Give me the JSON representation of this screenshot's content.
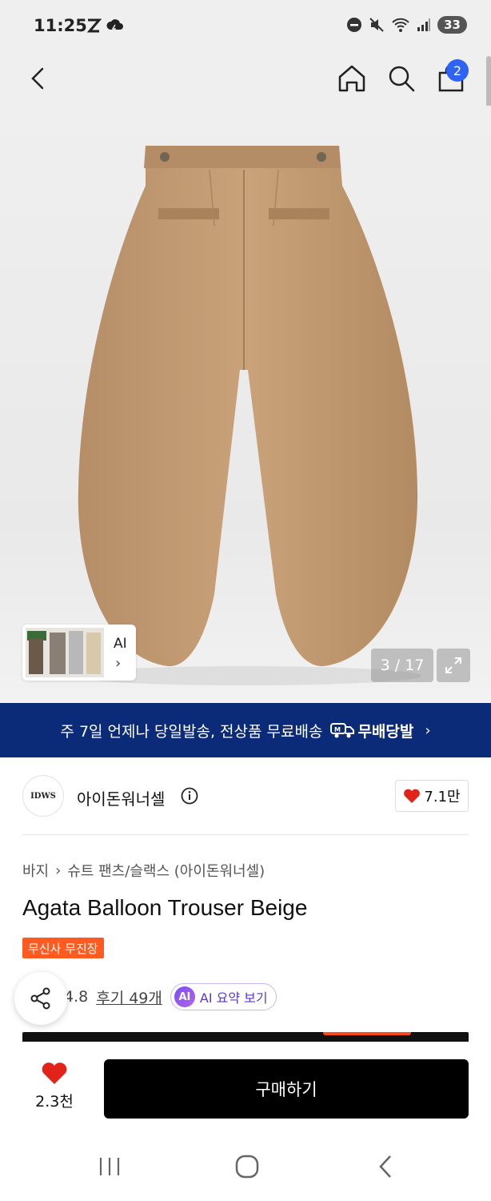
{
  "status_bar": {
    "time": "11:25",
    "battery": "33",
    "left_icons": [
      "z-app-icon",
      "weather-icon"
    ],
    "right_icons": [
      "dnd-icon",
      "mute-icon",
      "wifi-icon",
      "signal-icon",
      "battery-icon"
    ]
  },
  "header": {
    "back_icon": "chevron-left-icon",
    "home_icon": "home-icon",
    "search_icon": "search-icon",
    "cart_icon": "cart-icon",
    "cart_badge": "2"
  },
  "gallery": {
    "ai_label": "AI",
    "counter": "3 / 17",
    "expand_icon": "expand-icon",
    "image_subject": "beige-balloon-trouser-photo"
  },
  "banner": {
    "text": "주 7일 언제나 당일발송, 전상품 무료배송",
    "logo_text": "무배당발",
    "colors": {
      "background": "#0b2a78"
    }
  },
  "brand": {
    "avatar_text": "IDWS",
    "name": "아이돈워너셀",
    "like_count": "7.1만"
  },
  "product": {
    "breadcrumb": [
      "바지",
      "슈트 팬츠/슬랙스 (아이돈워너셀)"
    ],
    "title": "Agata Balloon Trouser Beige",
    "badge": "무신사 무진장",
    "rating": "4.8",
    "reviews": "후기 49개",
    "ai_chip": "AI",
    "ai_summary": "AI 요약 보기"
  },
  "bottom": {
    "like_count": "2.3천",
    "buy_label": "구매하기"
  },
  "colors": {
    "accent_badge": "#ff5a1f",
    "cart_badge": "#2f63f5",
    "heart": "#e2231a"
  }
}
